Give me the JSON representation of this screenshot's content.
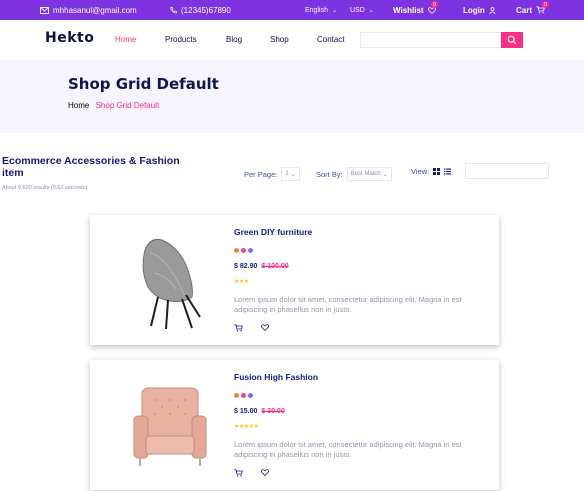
{
  "topbar": {
    "email": "mhhasanul@gmail.com",
    "phone": "(12345)67890",
    "language": "English",
    "currency": "USD",
    "wishlist": "Wishlist",
    "wishlist_count": "0",
    "login": "Login",
    "cart": "Cart",
    "cart_count": "0"
  },
  "nav": {
    "logo": "Hekto",
    "links": [
      "Home",
      "Products",
      "Blog",
      "Shop",
      "Contact"
    ]
  },
  "banner": {
    "title": "Shop Grid Default",
    "crumb_home": "Home",
    "crumb_current": "Shop Grid Default"
  },
  "toolbar": {
    "heading": "Ecommerce Accessories & Fashion item",
    "results": "About 9,620 results (0.62 seconds)",
    "per_page_label": "Per Page:",
    "per_page_value": "1",
    "sort_label": "Sort By:",
    "sort_value": "Best Match",
    "view_label": "View:"
  },
  "products": [
    {
      "name": "Green DIY furniture",
      "price": "$ 82.90",
      "old_price": "$ 100.00",
      "stars": "★★★",
      "description": "Lorem ipsum dolor sit amet, consectetur adipiscing elit. Magna in est adipiscing in phasellus non in justo.",
      "dot_colors": [
        "#DE9034",
        "#EC42A2",
        "#8568FF"
      ]
    },
    {
      "name": "Fusion High Fashion",
      "price": "$ 15.00",
      "old_price": "$ 30.00",
      "stars": "★★★★★",
      "description": "Lorem ipsum dolor sit amet, consectetur adipiscing elit. Magna in est adipiscing in phasellus non in justo.",
      "dot_colors": [
        "#DE9034",
        "#EC42A2",
        "#8568FF"
      ]
    }
  ],
  "colors": {
    "accent": "#7E33E0",
    "pink": "#FB2E86",
    "navy": "#151875",
    "banner_bg": "#F6F5FF"
  }
}
